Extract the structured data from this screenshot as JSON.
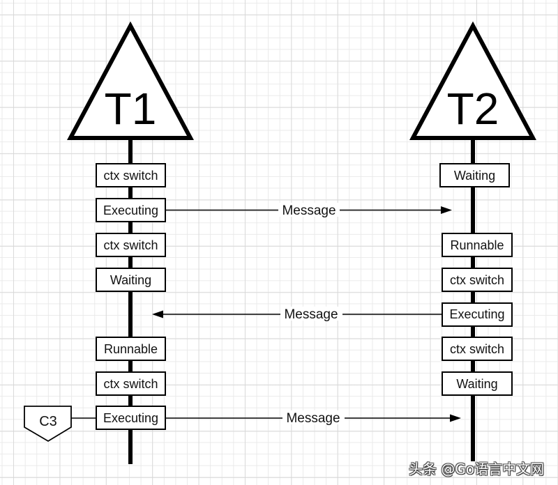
{
  "threads": [
    {
      "id": "T1",
      "label": "T1",
      "states": [
        "ctx switch",
        "Executing",
        "ctx switch",
        "Waiting",
        "Runnable",
        "ctx switch",
        "Executing"
      ]
    },
    {
      "id": "T2",
      "label": "T2",
      "states": [
        "Waiting",
        "Runnable",
        "ctx switch",
        "Executing",
        "ctx switch",
        "Waiting"
      ]
    }
  ],
  "messages": [
    {
      "label": "Message",
      "from": "T1",
      "to": "T2",
      "from_state": "Executing"
    },
    {
      "label": "Message",
      "from": "T2",
      "to": "T1",
      "from_state": "Executing"
    },
    {
      "label": "Message",
      "from": "T1",
      "to": "T2",
      "from_state": "Executing"
    }
  ],
  "external": {
    "label": "C3",
    "attached_to": "T1",
    "state": "Executing"
  },
  "watermark": "头条 @Go语言中文网"
}
